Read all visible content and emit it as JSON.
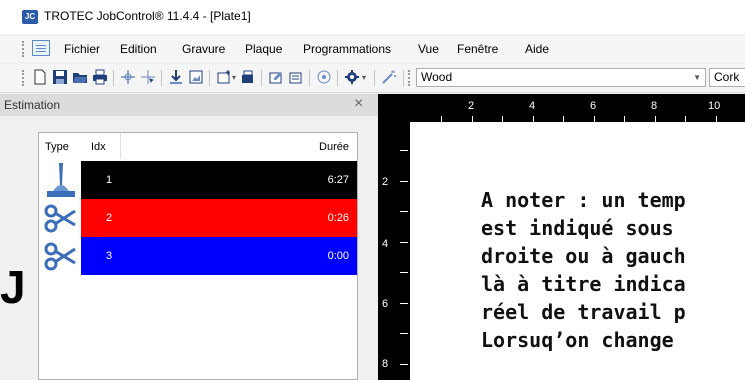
{
  "window": {
    "title": "TROTEC JobControl® 11.4.4 - [Plate1]",
    "logo_text": "JC"
  },
  "menu": {
    "items": [
      "Fichier",
      "Edition",
      "Gravure",
      "Plaque",
      "Programmations",
      "Vue",
      "Fenêtre",
      "Aide"
    ]
  },
  "toolbar": {
    "material_group": "Wood",
    "material": "Cork"
  },
  "panel": {
    "title": "Estimation",
    "close_glyph": "×",
    "columns": {
      "type": "Type",
      "idx": "Idx",
      "duration": "Durée"
    },
    "rows": [
      {
        "idx": "1",
        "duration": "6:27",
        "color": "#000000",
        "icon": "laser-icon"
      },
      {
        "idx": "2",
        "duration": "0:26",
        "color": "#ff0000",
        "icon": "scissors-icon"
      },
      {
        "idx": "3",
        "duration": "0:00",
        "color": "#0000ff",
        "icon": "scissors-icon"
      }
    ]
  },
  "overlay": {
    "letter": "J"
  },
  "ruler": {
    "horizontal": [
      "2",
      "4",
      "6",
      "8",
      "10"
    ],
    "vertical": [
      "2",
      "4",
      "6",
      "8"
    ]
  },
  "canvas": {
    "lines": [
      "A noter : un temp",
      "est indiqué sous",
      "droite ou à gauch",
      "là à titre indica",
      "réel de travail p",
      "Lorsuq’on change"
    ]
  }
}
